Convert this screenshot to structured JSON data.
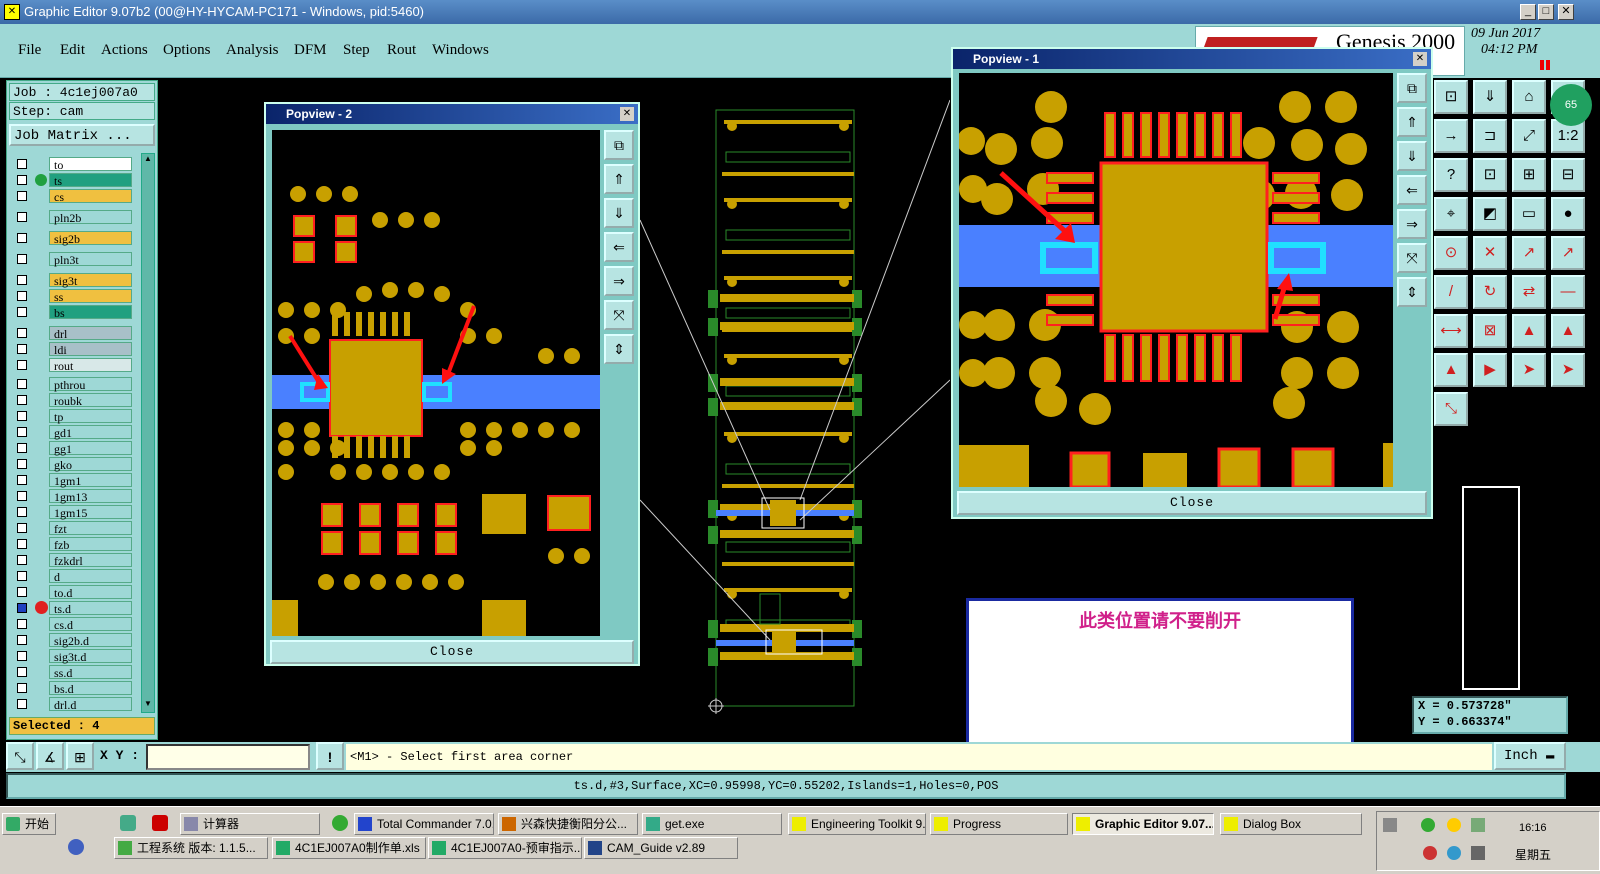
{
  "window": {
    "title": "Graphic Editor 9.07b2 (00@HY-HYCAM-PC171 - Windows, pid:5460)"
  },
  "menu": [
    "File",
    "Edit",
    "Actions",
    "Options",
    "Analysis",
    "DFM",
    "Step",
    "Rout",
    "Windows"
  ],
  "brand": {
    "name": "Genesis 2000",
    "date": "09 Jun 2017",
    "time": "04:12 PM",
    "badge": "65"
  },
  "job": {
    "job_line": "Job : 4c1ej007a0",
    "step_line": "Step: cam",
    "matrix_button": "Job Matrix ..."
  },
  "layers": [
    {
      "name": "to",
      "color": "#ffffff"
    },
    {
      "name": "ts",
      "color": "#20a080"
    },
    {
      "name": "cs",
      "color": "#f0c040"
    },
    {
      "name": "pln2b",
      "color": "#9ed8d6"
    },
    {
      "name": "sig2b",
      "color": "#f0c040"
    },
    {
      "name": "pln3t",
      "color": "#9ed8d6"
    },
    {
      "name": "sig3t",
      "color": "#f0c040"
    },
    {
      "name": "ss",
      "color": "#f0c040"
    },
    {
      "name": "bs",
      "color": "#20a080"
    },
    {
      "name": "drl",
      "color": "#a8c0c8"
    },
    {
      "name": "ldi",
      "color": "#a8c0c8"
    },
    {
      "name": "rout",
      "color": "#d8e8e8"
    },
    {
      "name": "pthrou",
      "color": "#9ed8d6"
    },
    {
      "name": "roubk",
      "color": "#9ed8d6"
    },
    {
      "name": "tp",
      "color": "#9ed8d6"
    },
    {
      "name": "gd1",
      "color": "#9ed8d6"
    },
    {
      "name": "gg1",
      "color": "#9ed8d6"
    },
    {
      "name": "gko",
      "color": "#9ed8d6"
    },
    {
      "name": "1gm1",
      "color": "#9ed8d6"
    },
    {
      "name": "1gm13",
      "color": "#9ed8d6"
    },
    {
      "name": "1gm15",
      "color": "#9ed8d6"
    },
    {
      "name": "fzt",
      "color": "#9ed8d6"
    },
    {
      "name": "fzb",
      "color": "#9ed8d6"
    },
    {
      "name": "fzkdrl",
      "color": "#9ed8d6"
    },
    {
      "name": "d",
      "color": "#9ed8d6"
    },
    {
      "name": "to.d",
      "color": "#9ed8d6"
    },
    {
      "name": "ts.d",
      "color": "#9ed8d6"
    },
    {
      "name": "cs.d",
      "color": "#9ed8d6"
    },
    {
      "name": "sig2b.d",
      "color": "#9ed8d6"
    },
    {
      "name": "sig3t.d",
      "color": "#9ed8d6"
    },
    {
      "name": "ss.d",
      "color": "#9ed8d6"
    },
    {
      "name": "bs.d",
      "color": "#9ed8d6"
    },
    {
      "name": "drl.d",
      "color": "#9ed8d6"
    }
  ],
  "selected": "Selected : 4",
  "popview2": {
    "title": "Popview - 2",
    "close": "Close"
  },
  "popview1": {
    "title": "Popview - 1",
    "close": "Close"
  },
  "note": {
    "text": "此类位置请不要削开"
  },
  "coords": {
    "x": "X = 0.573728\"",
    "y": "Y = 0.663374\""
  },
  "status": {
    "xy_label": "X Y :",
    "prompt": "<M1> - Select first area corner",
    "units": "Inch"
  },
  "info": "ts.d,#3,Surface,XC=0.95998,YC=0.55202,Islands=1,Holes=0,POS",
  "taskbar": {
    "start": "开始",
    "row1": [
      "计算器",
      "Total Commander 7.0...",
      "兴森快捷衡阳分公...",
      "get.exe",
      "Engineering Toolkit 9....",
      "Progress",
      "Graphic Editor 9.07...",
      "Dialog Box"
    ],
    "row2": [
      "工程系统  版本: 1.1.5...",
      "4C1EJ007A0制作单.xls",
      "4C1EJ007A0-预审指示...",
      "CAM_Guide v2.89"
    ],
    "clock": "16:16",
    "weekday": "星期五"
  },
  "colors": {
    "panel": "#9ed8d6",
    "copper": "#c8a000",
    "pad_outline": "#ff2020",
    "trace": "#4a80ff",
    "cyan": "#20e0ff",
    "selection": "#00ff00"
  }
}
